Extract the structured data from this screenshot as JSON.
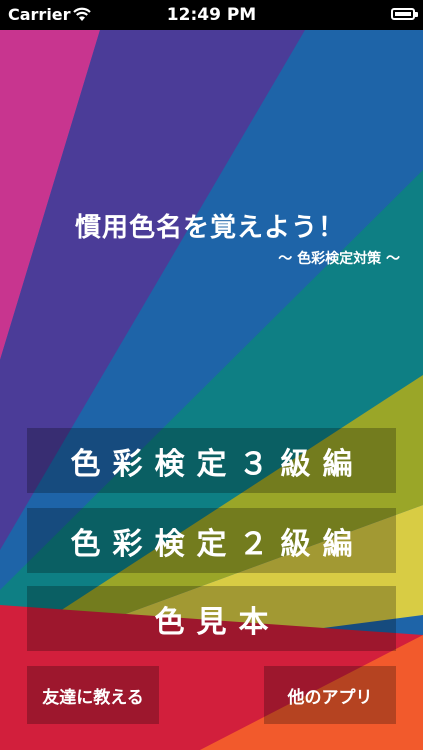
{
  "status_bar": {
    "carrier": "Carrier",
    "time": "12:49 PM"
  },
  "header": {
    "title": "慣用色名を覚えよう！",
    "subtitle": "〜 色彩検定対策 〜"
  },
  "buttons": {
    "grade3": "色彩検定３級編",
    "grade2": "色彩検定２級編",
    "samples": "色見本",
    "tell_friend": "友達に教える",
    "other_apps": "他のアプリ"
  },
  "colors": {
    "magenta": "#C8358F",
    "purple": "#4B3C98",
    "blue": "#1E64A8",
    "teal": "#0E7F84",
    "olive": "#9AA628",
    "yellow": "#D8CC44",
    "red": "#D21F3C",
    "orange": "#F25A2C"
  }
}
